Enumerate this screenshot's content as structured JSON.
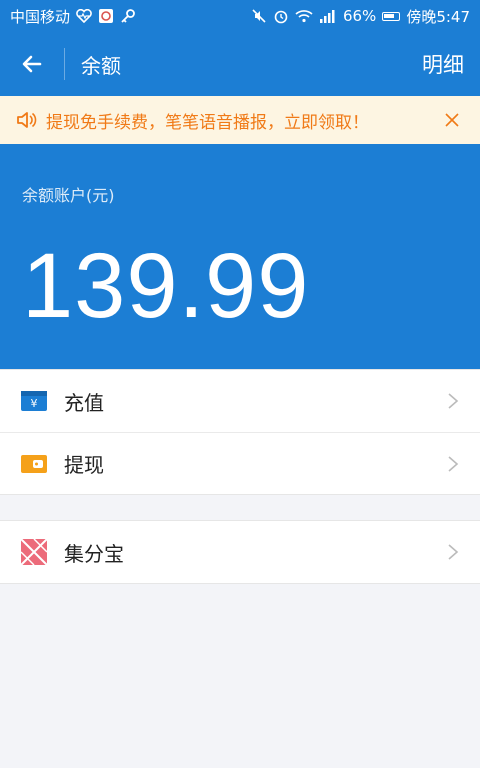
{
  "status_bar": {
    "carrier": "中国移动",
    "battery_percent": "66%",
    "time": "傍晚5:47"
  },
  "app_bar": {
    "title": "余额",
    "detail_label": "明细"
  },
  "notice": {
    "text": "提现免手续费，笔笔语音播报，立即领取！",
    "color": "#f07a17",
    "background": "#fdf5e2"
  },
  "balance": {
    "label": "余额账户(元)",
    "amount": "139.99"
  },
  "menu": {
    "group1": [
      {
        "label": "充值",
        "icon": "recharge-icon"
      },
      {
        "label": "提现",
        "icon": "withdraw-icon"
      }
    ],
    "group2": [
      {
        "label": "集分宝",
        "icon": "jifenbao-icon"
      }
    ]
  },
  "colors": {
    "primary": "#1c7ed4",
    "background": "#f3f4f8"
  }
}
